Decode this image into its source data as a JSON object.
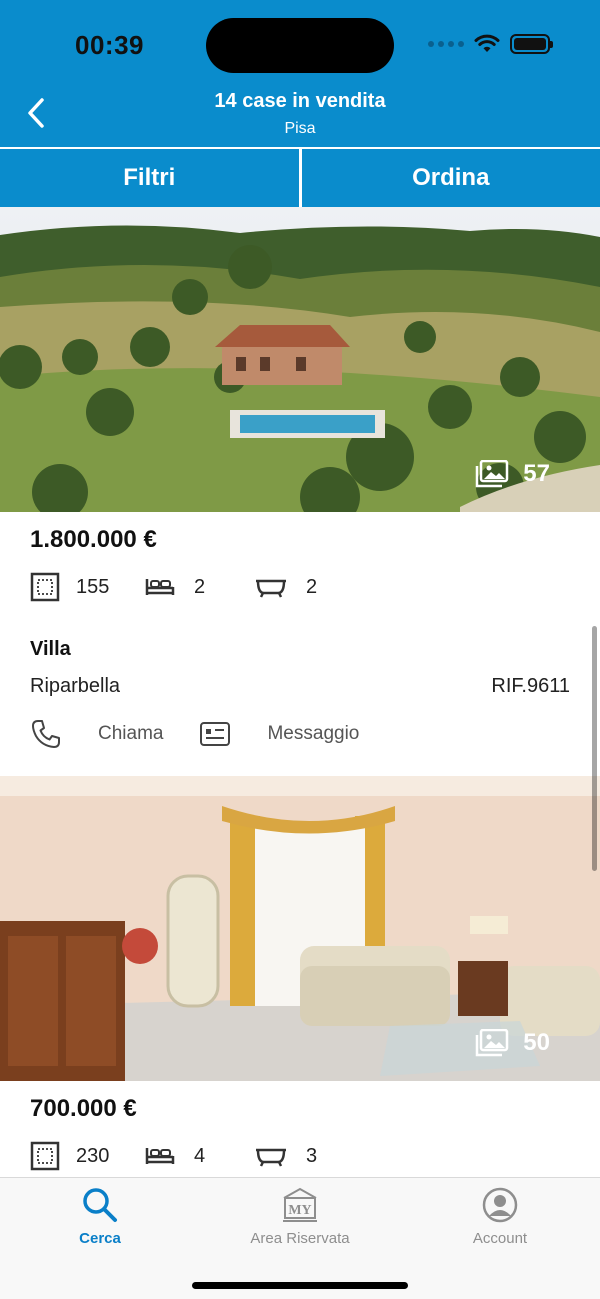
{
  "status": {
    "time": "00:39"
  },
  "header": {
    "title": "14 case in vendita",
    "subtitle": "Pisa",
    "filter_label": "Filtri",
    "sort_label": "Ordina"
  },
  "listings": [
    {
      "photo_count": "57",
      "price": "1.800.000 €",
      "area": "155",
      "bedrooms": "2",
      "bathrooms": "2",
      "type": "Villa",
      "location": "Riparbella",
      "ref": "RIF.9611",
      "call_label": "Chiama",
      "message_label": "Messaggio"
    },
    {
      "photo_count": "50",
      "price": "700.000 €",
      "area": "230",
      "bedrooms": "4",
      "bathrooms": "3"
    }
  ],
  "tabbar": {
    "items": [
      {
        "label": "Cerca",
        "icon": "search-icon",
        "active": true
      },
      {
        "label": "Area Riservata",
        "icon": "my-area-icon",
        "logo_text": "MY",
        "active": false
      },
      {
        "label": "Account",
        "icon": "account-icon",
        "active": false
      }
    ]
  },
  "colors": {
    "brand": "#0a8ccc",
    "active_tab": "#0a7fc8",
    "inactive_tab": "#8e8e8e"
  }
}
